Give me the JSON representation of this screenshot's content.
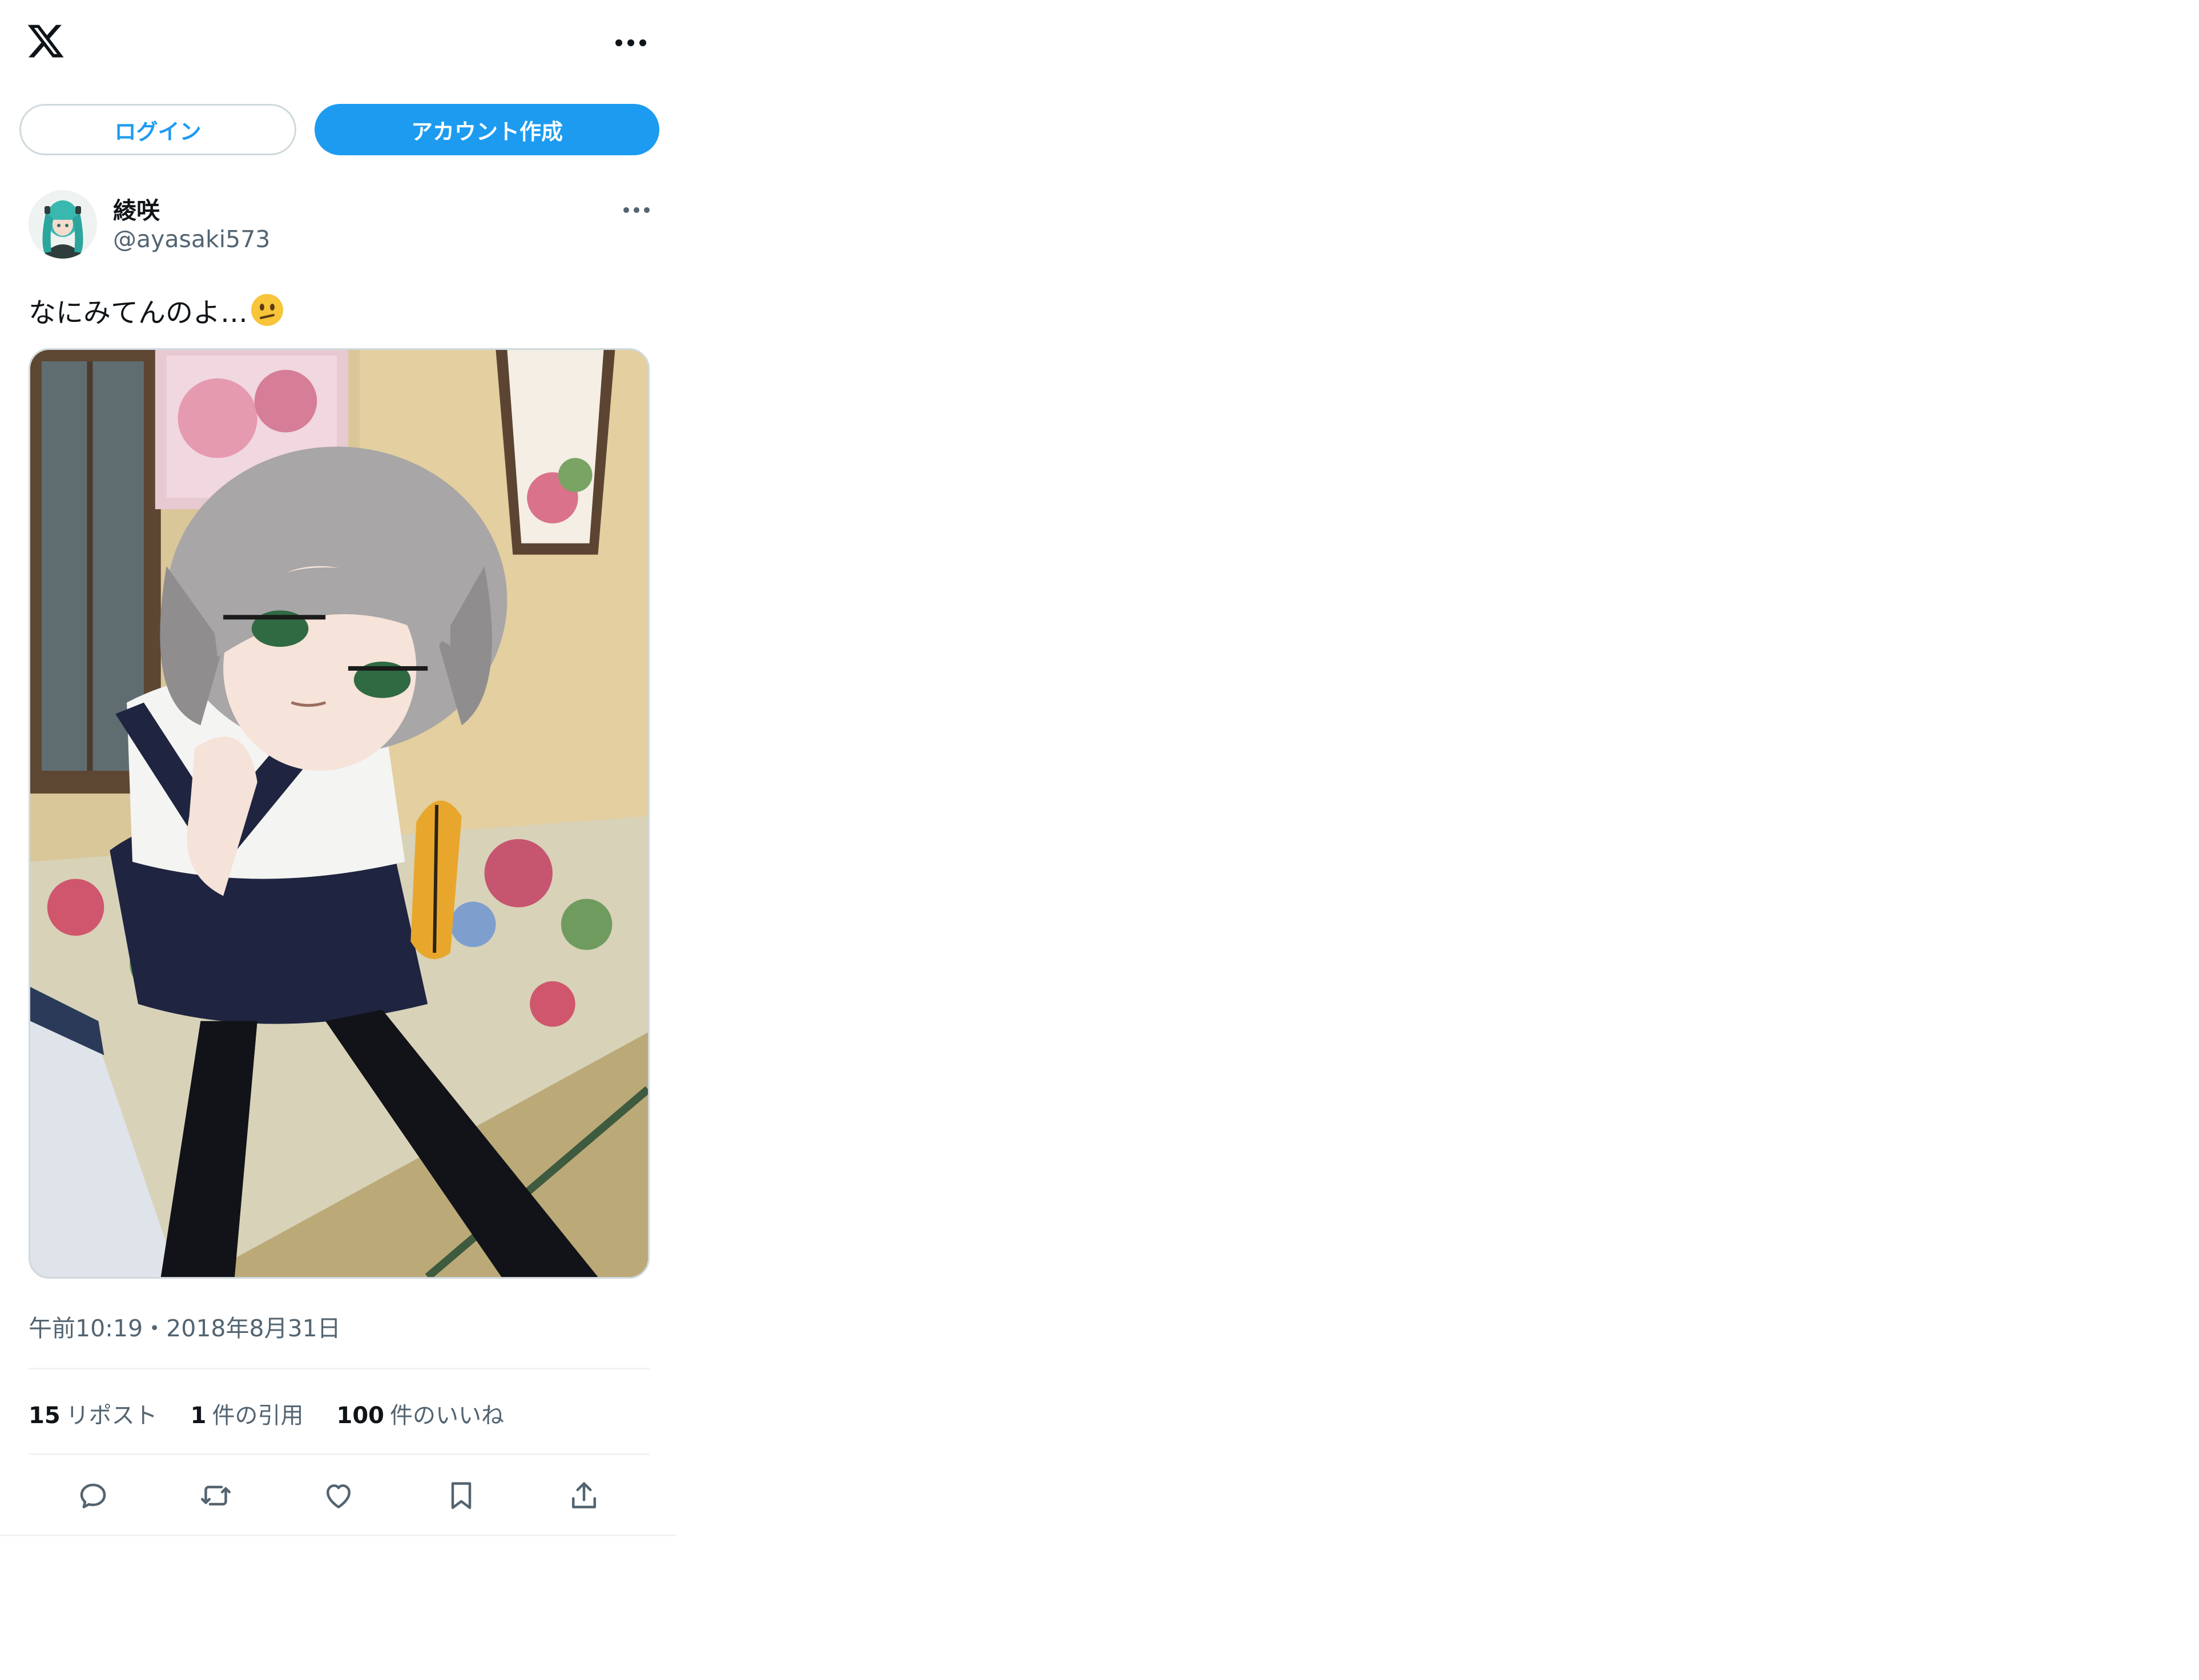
{
  "header": {
    "logo_icon": "x-logo-icon",
    "more_icon": "more-horizontal-icon"
  },
  "auth": {
    "login_label": "ログイン",
    "signup_label": "アカウント作成"
  },
  "post": {
    "author": {
      "display_name": "綾咲",
      "handle": "@ayasaki573"
    },
    "text": "なにみてんのよ…",
    "text_emoji": "confused-face-icon",
    "timestamp": "午前10:19・2018年8月31日",
    "stats": {
      "reposts_count": "15",
      "reposts_label": "リポスト",
      "quotes_count": "1",
      "quotes_label": "件の引用",
      "likes_count": "100",
      "likes_label": "件のいいね"
    },
    "actions": [
      "reply-icon",
      "repost-icon",
      "like-icon",
      "bookmark-icon",
      "share-icon"
    ]
  },
  "colors": {
    "accent": "#1d9bf0",
    "text_primary": "#0f1419",
    "text_secondary": "#536471",
    "border": "#cfd9de"
  }
}
